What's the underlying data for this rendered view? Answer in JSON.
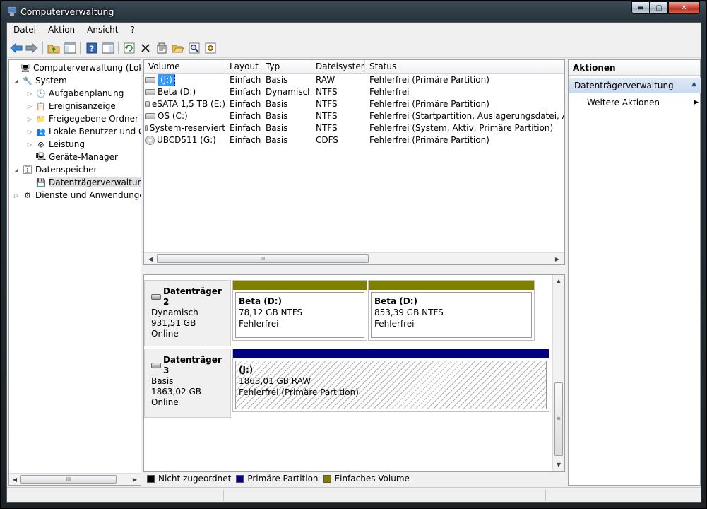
{
  "window": {
    "title": "Computerverwaltung"
  },
  "window_buttons": {
    "minimize": "▬",
    "maximize": "▢",
    "close": "✕"
  },
  "menu": [
    "Datei",
    "Aktion",
    "Ansicht",
    "?"
  ],
  "toolbar_icons": [
    "back-arrow-icon",
    "forward-arrow-icon",
    "up-folder-icon",
    "show-hide-tree-icon",
    "help-icon",
    "properties-pane-icon",
    "refresh-icon",
    "delete-icon",
    "properties-icon",
    "open-icon",
    "search-icon",
    "settings-icon"
  ],
  "tree": [
    {
      "label": "Computerverwaltung (Lokal)",
      "level": 0,
      "expander": "",
      "icon": "🖥"
    },
    {
      "label": "System",
      "level": 1,
      "expander": "◢",
      "icon": "🔧"
    },
    {
      "label": "Aufgabenplanung",
      "level": 2,
      "expander": "▷",
      "icon": "🕑"
    },
    {
      "label": "Ereignisanzeige",
      "level": 2,
      "expander": "▷",
      "icon": "📋"
    },
    {
      "label": "Freigegebene Ordner",
      "level": 2,
      "expander": "▷",
      "icon": "📁"
    },
    {
      "label": "Lokale Benutzer und Gruppen",
      "level": 2,
      "expander": "▷",
      "icon": "👥"
    },
    {
      "label": "Leistung",
      "level": 2,
      "expander": "▷",
      "icon": "⊘"
    },
    {
      "label": "Geräte-Manager",
      "level": 2,
      "expander": "",
      "icon": "🖳"
    },
    {
      "label": "Datenspeicher",
      "level": 1,
      "expander": "◢",
      "icon": "🗄"
    },
    {
      "label": "Datenträgerverwaltung",
      "level": 2,
      "expander": "",
      "icon": "💾",
      "selected": true
    },
    {
      "label": "Dienste und Anwendungen",
      "level": 1,
      "expander": "▷",
      "icon": "⚙"
    }
  ],
  "volumes": {
    "columns": [
      "Volume",
      "Layout",
      "Typ",
      "Dateisystem",
      "Status"
    ],
    "rows": [
      {
        "volume": "(J:)",
        "layout": "Einfach",
        "typ": "Basis",
        "fs": "RAW",
        "status": "Fehlerfrei (Primäre Partition)",
        "icon": "disk"
      },
      {
        "volume": "Beta (D:)",
        "layout": "Einfach",
        "typ": "Dynamisch",
        "fs": "NTFS",
        "status": "Fehlerfrei",
        "icon": "disk"
      },
      {
        "volume": "eSATA 1,5 TB (E:)",
        "layout": "Einfach",
        "typ": "Basis",
        "fs": "NTFS",
        "status": "Fehlerfrei (Primäre Partition)",
        "icon": "disk"
      },
      {
        "volume": "OS (C:)",
        "layout": "Einfach",
        "typ": "Basis",
        "fs": "NTFS",
        "status": "Fehlerfrei (Startpartition, Auslagerungsdatei, Absturzabbild)",
        "icon": "disk"
      },
      {
        "volume": "System-reserviert",
        "layout": "Einfach",
        "typ": "Basis",
        "fs": "NTFS",
        "status": "Fehlerfrei (System, Aktiv, Primäre Partition)",
        "icon": "disk"
      },
      {
        "volume": "UBCD511 (G:)",
        "layout": "Einfach",
        "typ": "Basis",
        "fs": "CDFS",
        "status": "Fehlerfrei (Primäre Partition)",
        "icon": "cd"
      }
    ]
  },
  "scroll": {
    "thumb_grip": "III",
    "vgrip": "≡",
    "left": "◀",
    "right": "▶",
    "up": "▲",
    "down": "▼"
  },
  "disks": [
    {
      "name": "Datenträger 2",
      "type": "Dynamisch",
      "size": "931,51 GB",
      "state": "Online",
      "partitions": [
        {
          "name": "Beta  (D:)",
          "size": "78,12 GB NTFS",
          "status": "Fehlerfrei",
          "bar_color": "#808000",
          "hatched": false
        },
        {
          "name": "Beta  (D:)",
          "size": "853,39 GB NTFS",
          "status": "Fehlerfrei",
          "bar_color": "#808000",
          "hatched": false
        }
      ]
    },
    {
      "name": "Datenträger 3",
      "type": "Basis",
      "size": "1863,02 GB",
      "state": "Online",
      "partitions": [
        {
          "name": "(J:)",
          "size": "1863,01 GB RAW",
          "status": "Fehlerfrei (Primäre Partition)",
          "bar_color": "#000080",
          "hatched": true
        }
      ]
    }
  ],
  "legend": [
    {
      "label": "Nicht zugeordnet",
      "color": "#000000"
    },
    {
      "label": "Primäre Partition",
      "color": "#000080"
    },
    {
      "label": "Einfaches Volume",
      "color": "#808000"
    }
  ],
  "actions": {
    "header": "Aktionen",
    "section": "Datenträgerverwaltung",
    "section_arrow": "▲",
    "item": "Weitere Aktionen",
    "item_arrow": "▶"
  }
}
